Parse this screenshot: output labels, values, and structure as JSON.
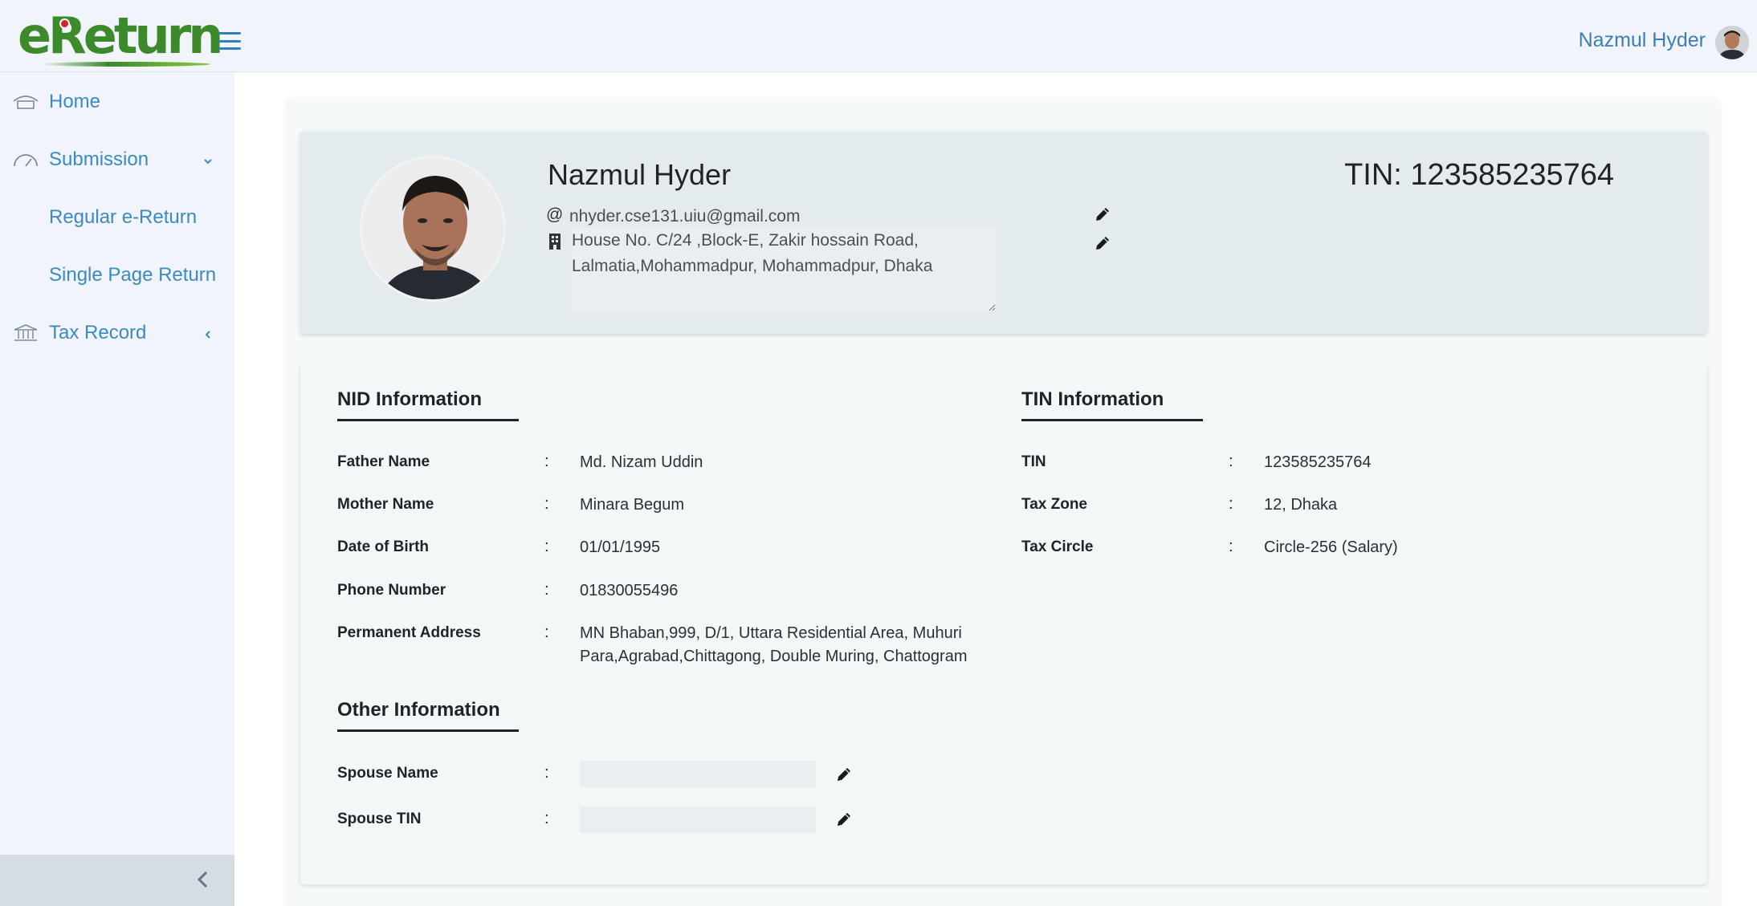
{
  "header": {
    "logo_text": "eReturn",
    "user_name": "Nazmul Hyder"
  },
  "sidebar": {
    "items": [
      {
        "label": "Home",
        "icon": "home-icon"
      },
      {
        "label": "Submission",
        "icon": "gauge-icon",
        "caret": "chevron-down-icon"
      },
      {
        "label": "Regular e-Return"
      },
      {
        "label": "Single Page Return"
      },
      {
        "label": "Tax Record",
        "icon": "bank-icon",
        "caret": "chevron-left-icon"
      }
    ]
  },
  "profile": {
    "name": "Nazmul Hyder",
    "tin_label": "TIN: 123585235764",
    "email_symbol": "@",
    "email": "nhyder.cse131.uiu@gmail.com",
    "address": "House No. C/24 ,Block-E, Zakir hossain Road, Lalmatia,Mohammadpur, Mohammadpur, Dhaka"
  },
  "nid": {
    "title": "NID Information",
    "rows": [
      {
        "label": "Father Name",
        "value": "Md. Nizam Uddin"
      },
      {
        "label": "Mother Name",
        "value": "Minara Begum"
      },
      {
        "label": "Date of Birth",
        "value": "01/01/1995"
      },
      {
        "label": "Phone Number",
        "value": "01830055496"
      },
      {
        "label": "Permanent Address",
        "value": "MN Bhaban,999, D/1, Uttara Residential Area, Muhuri Para,Agrabad,Chittagong, Double Muring, Chattogram"
      }
    ]
  },
  "tin": {
    "title": "TIN Information",
    "rows": [
      {
        "label": "TIN",
        "value": "123585235764"
      },
      {
        "label": "Tax Zone",
        "value": "12, Dhaka"
      },
      {
        "label": "Tax Circle",
        "value": "Circle-256 (Salary)"
      }
    ]
  },
  "other": {
    "title": "Other Information",
    "rows": [
      {
        "label": "Spouse Name",
        "value": ""
      },
      {
        "label": "Spouse TIN",
        "value": ""
      }
    ]
  },
  "colon": ":",
  "colors": {
    "brand_green": "#3c8a2a",
    "link_blue": "#3a8ac4",
    "sidebar_bg": "#f1f4fa"
  }
}
